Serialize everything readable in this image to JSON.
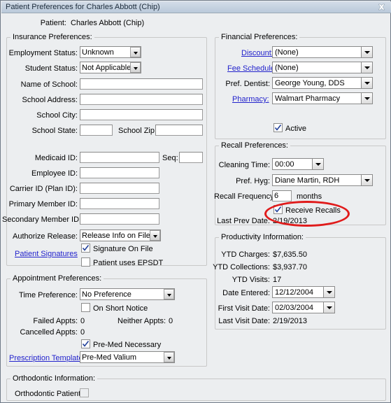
{
  "window": {
    "title": "Patient Preferences for Charles Abbott (Chip)",
    "close_icon": "close-x-icon"
  },
  "patient": {
    "label": "Patient:",
    "name": "Charles Abbott (Chip)"
  },
  "insurance": {
    "group_title": "Insurance Preferences:",
    "employment_status": {
      "label": "Employment Status:",
      "value": "Unknown"
    },
    "student_status": {
      "label": "Student Status:",
      "value": "Not Applicable"
    },
    "name_of_school": {
      "label": "Name of School:",
      "value": ""
    },
    "school_address": {
      "label": "School Address:",
      "value": ""
    },
    "school_city": {
      "label": "School City:",
      "value": ""
    },
    "school_state": {
      "label": "School State:",
      "value": ""
    },
    "school_zip": {
      "label": "School Zip:",
      "value": ""
    },
    "medicaid_id": {
      "label": "Medicaid ID:",
      "value": ""
    },
    "seq": {
      "label": "Seq:",
      "value": ""
    },
    "employee_id": {
      "label": "Employee ID:",
      "value": ""
    },
    "carrier_id": {
      "label": "Carrier ID (Plan ID):",
      "value": ""
    },
    "primary_member_id": {
      "label": "Primary Member ID:",
      "value": ""
    },
    "secondary_member_id": {
      "label": "Secondary Member ID:",
      "value": ""
    },
    "authorize_release": {
      "label": "Authorize Release:",
      "value": "Release Info on File"
    },
    "patient_signatures_link": "Patient Signatures",
    "signature_on_file": {
      "label": "Signature On File",
      "checked": true
    },
    "patient_uses_epsdt": {
      "label": "Patient uses EPSDT",
      "checked": false
    }
  },
  "appointment": {
    "group_title": "Appointment Preferences:",
    "time_preference": {
      "label": "Time Preference:",
      "value": "No Preference"
    },
    "on_short_notice": {
      "label": "On Short Notice",
      "checked": false
    },
    "failed_appts": {
      "label": "Failed Appts:",
      "value": "0"
    },
    "neither_appts": {
      "label": "Neither Appts:",
      "value": "0"
    },
    "cancelled_appts": {
      "label": "Cancelled Appts:",
      "value": "0"
    },
    "pre_med_necessary": {
      "label": "Pre-Med Necessary",
      "checked": true
    },
    "prescription_template_link": "Prescription Template:",
    "prescription_template_value": "Pre-Med Valium"
  },
  "orthodontic": {
    "group_title": "Orthodontic Information:",
    "orthodontic_patient": {
      "label": "Orthodontic Patient:",
      "checked": false
    }
  },
  "financial": {
    "group_title": "Financial Preferences:",
    "discount": {
      "label": "Discount:",
      "value": "(None)"
    },
    "fee_schedule": {
      "label": "Fee Schedule:",
      "value": "(None)"
    },
    "pref_dentist": {
      "label": "Pref. Dentist:",
      "value": "George Young, DDS"
    },
    "pharmacy": {
      "label": "Pharmacy:",
      "value": "Walmart Pharmacy"
    },
    "active": {
      "label": "Active",
      "checked": true
    }
  },
  "recall": {
    "group_title": "Recall Preferences:",
    "cleaning_time": {
      "label": "Cleaning Time:",
      "value": "00:00"
    },
    "pref_hyg": {
      "label": "Pref. Hyg:",
      "value": "Diane Martin, RDH"
    },
    "recall_frequency": {
      "label": "Recall Frequency:",
      "value": "6",
      "unit": "months"
    },
    "receive_recalls": {
      "label": "Receive Recalls",
      "checked": true
    },
    "last_prev_date": {
      "label": "Last Prev Date:",
      "value": "2/19/2013"
    }
  },
  "productivity": {
    "group_title": "Productivity Information:",
    "ytd_charges": {
      "label": "YTD Charges:",
      "value": "$7,635.50"
    },
    "ytd_collections": {
      "label": "YTD Collections:",
      "value": "$3,937.70"
    },
    "ytd_visits": {
      "label": "YTD Visits:",
      "value": "17"
    },
    "date_entered": {
      "label": "Date Entered:",
      "value": "12/12/2004"
    },
    "first_visit_date": {
      "label": "First Visit Date:",
      "value": "02/03/2004"
    },
    "last_visit_date": {
      "label": "Last Visit Date:",
      "value": "2/19/2013"
    }
  },
  "annotation": {
    "highlight": "red-ellipse-receive-recalls",
    "color": "#e01b1b"
  }
}
